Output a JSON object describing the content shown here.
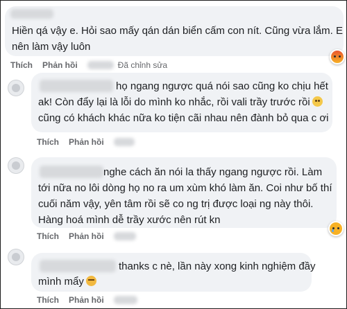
{
  "labels": {
    "like": "Thích",
    "reply": "Phản hồi",
    "edited": "Đã chỉnh sửa"
  },
  "comments": [
    {
      "lines": [
        "Hiền qá vậy e. Hỏi sao mấy qán dán biển cấm con nít. Cũng vừa lắm. E",
        "nên làm vậy luôn"
      ],
      "reaction": "angry-icon"
    },
    {
      "lines": [
        "họ ngang ngược quá nói sao cũng ko chịu hết",
        "ak! Còn đẩy lại là lỗi do mình ko nhắc, rồi vali trầy trước rồi",
        "cũng có khách khác nữa ko tiện cãi nhau nên đành bỏ qua c ơi"
      ]
    },
    {
      "lines": [
        "nghe cách ăn nói la thấy ngang ngược rồi. Làm",
        "tới nữa no lôi dòng họ no ra um xùm khó làm ăn. Coi như bố thí",
        "cuối năm vậy, yên tâm rồi sẽ co ng trị được loại ng này thôi.",
        "Hàng hoá mình dễ trầy xước nên rút kn"
      ],
      "reaction": "sad-icon"
    },
    {
      "lines": [
        "thanks c nè, lần này xong kinh nghiệm đầy",
        "mình mẩy"
      ]
    }
  ]
}
